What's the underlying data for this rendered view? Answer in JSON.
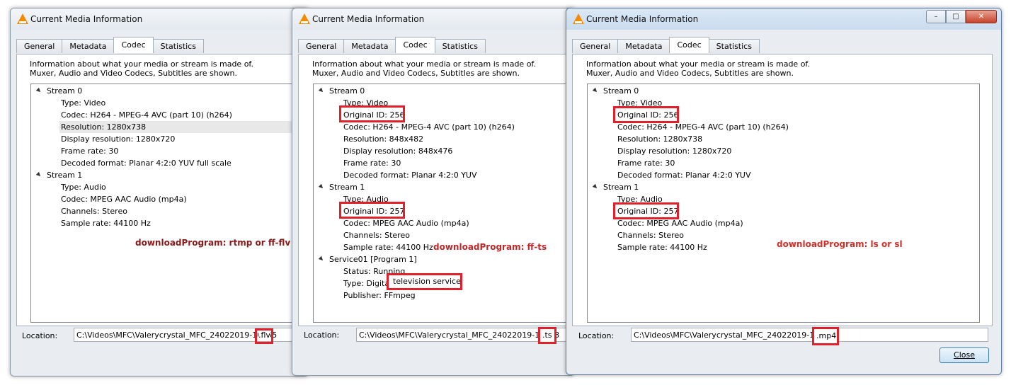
{
  "windows": [
    {
      "title": "Current Media Information",
      "tabs": [
        "General",
        "Metadata",
        "Codec",
        "Statistics"
      ],
      "active_tab": "Codec",
      "info_line1": "Information about what your media or stream is made of.",
      "info_line2": "Muxer, Audio and Video Codecs, Subtitles are shown.",
      "tree": [
        {
          "text": "Stream 0",
          "level": 0
        },
        {
          "text": "Type: Video",
          "level": 1
        },
        {
          "text": "Codec: H264 - MPEG-4 AVC (part 10) (h264)",
          "level": 1
        },
        {
          "text": "Resolution: 1280x738",
          "level": 1
        },
        {
          "text": "Display resolution: 1280x720",
          "level": 1
        },
        {
          "text": "Frame rate: 30",
          "level": 1
        },
        {
          "text": "Decoded format: Planar 4:2:0 YUV full scale",
          "level": 1
        },
        {
          "text": "Stream 1",
          "level": 0
        },
        {
          "text": "Type: Audio",
          "level": 1
        },
        {
          "text": "Codec: MPEG AAC Audio (mp4a)",
          "level": 1
        },
        {
          "text": "Channels: Stereo",
          "level": 1
        },
        {
          "text": "Sample rate: 44100 Hz",
          "level": 1
        }
      ],
      "annotation": "downloadProgram: rtmp or ff-flv",
      "annotation_color": "#8b1a1a",
      "location_label": "Location:",
      "location_value": "C:\\Videos\\MFC\\Valerycrystal_MFC_24022019-10055",
      "location_ext": ".flv"
    },
    {
      "title": "Current Media Information",
      "tabs": [
        "General",
        "Metadata",
        "Codec",
        "Statistics"
      ],
      "active_tab": "Codec",
      "info_line1": "Information about what your media or stream is made of.",
      "info_line2": "Muxer, Audio and Video Codecs, Subtitles are shown.",
      "tree": [
        {
          "text": "Stream 0",
          "level": 0
        },
        {
          "text": "Type: Video",
          "level": 1
        },
        {
          "text": "Original ID: 256",
          "level": 1
        },
        {
          "text": "Codec: H264 - MPEG-4 AVC (part 10) (h264)",
          "level": 1
        },
        {
          "text": "Resolution: 848x482",
          "level": 1
        },
        {
          "text": "Display resolution: 848x476",
          "level": 1
        },
        {
          "text": "Frame rate: 30",
          "level": 1
        },
        {
          "text": "Decoded format: Planar 4:2:0 YUV",
          "level": 1
        },
        {
          "text": "Stream 1",
          "level": 0
        },
        {
          "text": "Type: Audio",
          "level": 1
        },
        {
          "text": "Original ID: 257",
          "level": 1
        },
        {
          "text": "Codec: MPEG AAC Audio (mp4a)",
          "level": 1
        },
        {
          "text": "Channels: Stereo",
          "level": 1
        },
        {
          "text": "Sample rate: 44100 Hz",
          "level": 1
        },
        {
          "text": "Service01 [Program 1]",
          "level": 0
        },
        {
          "text": "Status: Running",
          "level": 1
        },
        {
          "text": "Type: Digital television service",
          "level": 1
        },
        {
          "text": "Publisher: FFmpeg",
          "level": 1
        }
      ],
      "annotation": "downloadProgram: ff-ts",
      "annotation_color": "#c0282a",
      "location_label": "Location:",
      "location_value": "C:\\Videos\\MFC\\Valerycrystal_MFC_24022019-10033",
      "location_ext": ".ts"
    },
    {
      "title": "Current Media Information",
      "tabs": [
        "General",
        "Metadata",
        "Codec",
        "Statistics"
      ],
      "active_tab": "Codec",
      "info_line1": "Information about what your media or stream is made of.",
      "info_line2": "Muxer, Audio and Video Codecs, Subtitles are shown.",
      "tree": [
        {
          "text": "Stream 0",
          "level": 0
        },
        {
          "text": "Type: Video",
          "level": 1
        },
        {
          "text": "Original ID: 256",
          "level": 1
        },
        {
          "text": "Codec: H264 - MPEG-4 AVC (part 10) (h264)",
          "level": 1
        },
        {
          "text": "Resolution: 1280x738",
          "level": 1
        },
        {
          "text": "Display resolution: 1280x720",
          "level": 1
        },
        {
          "text": "Frame rate: 30",
          "level": 1
        },
        {
          "text": "Decoded format: Planar 4:2:0 YUV",
          "level": 1
        },
        {
          "text": "Stream 1",
          "level": 0
        },
        {
          "text": "Type: Audio",
          "level": 1
        },
        {
          "text": "Original ID: 257",
          "level": 1
        },
        {
          "text": "Codec: MPEG AAC Audio (mp4a)",
          "level": 1
        },
        {
          "text": "Channels: Stereo",
          "level": 1
        },
        {
          "text": "Sample rate: 44100 Hz",
          "level": 1
        }
      ],
      "annotation": "downloadProgram: ls or sl",
      "annotation_color": "#d0302a",
      "location_label": "Location:",
      "location_value": "C:\\Videos\\MFC\\Valerycrystal_MFC_24022019-10045",
      "location_ext": ".mp4",
      "close_label": "Close",
      "window_buttons": [
        "minimize-icon",
        "maximize-icon",
        "close-icon"
      ]
    }
  ]
}
